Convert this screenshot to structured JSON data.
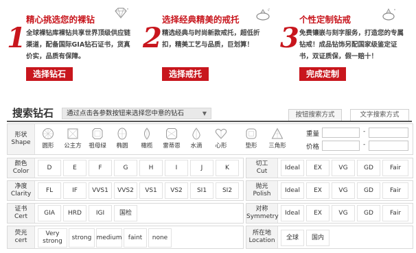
{
  "steps": [
    {
      "num": "1",
      "title": "精心挑选您的裸钻",
      "desc": "全球裸钻库裸钻共享世界顶级供应链渠道，配备国际GIA钻石证书，货真价实，品质有保障。",
      "button": "选择钻石"
    },
    {
      "num": "2",
      "title": "选择经典精美的戒托",
      "desc": "精选经典与时尚新款戒托，超低折扣，精美工艺与品质，巨划算！",
      "button": "选择戒托"
    },
    {
      "num": "3",
      "title": "个性定制钻戒",
      "desc": "免费镶嵌与刻字服务，打造您的专属钻戒！成品钻饰另配国家级鉴定证书，双证质保，假一赔十！",
      "button": "完成定制"
    }
  ],
  "search": {
    "title": "搜索钻石",
    "hint": "通过点击各参数按钮来选择您中意的钻石",
    "tab_button": "按钮搜索方式",
    "tab_text": "文字搜索方式"
  },
  "shape": {
    "label_cn": "形状",
    "label_en": "Shape",
    "items": [
      "圆形",
      "公主方",
      "祖母绿",
      "椭圆",
      "橄榄",
      "雷蒂恩",
      "水滴",
      "心形",
      "垫形",
      "三角形"
    ],
    "weight": "重量",
    "price": "价格",
    "dash": "-"
  },
  "color": {
    "label_cn": "颜色",
    "label_en": "Color",
    "values": [
      "D",
      "E",
      "F",
      "G",
      "H",
      "I",
      "J",
      "K"
    ]
  },
  "clarity": {
    "label_cn": "净度",
    "label_en": "Clarity",
    "values": [
      "FL",
      "IF",
      "VVS1",
      "VVS2",
      "VS1",
      "VS2",
      "SI1",
      "SI2"
    ]
  },
  "cert": {
    "label_cn": "证书",
    "label_en": "Cert",
    "values": [
      "GIA",
      "HRD",
      "IGI",
      "国检"
    ]
  },
  "fluor": {
    "label_cn": "荧光",
    "label_en": "cert",
    "values": [
      "Very strong",
      "strong",
      "medium",
      "faint",
      "none"
    ]
  },
  "cut": {
    "label_cn": "切工",
    "label_en": "Cut",
    "values": [
      "Ideal",
      "EX",
      "VG",
      "GD",
      "Fair"
    ]
  },
  "polish": {
    "label_cn": "抛光",
    "label_en": "Polish",
    "values": [
      "Ideal",
      "EX",
      "VG",
      "GD",
      "Fair"
    ]
  },
  "symmetry": {
    "label_cn": "对称",
    "label_en": "Symmetry",
    "values": [
      "Ideal",
      "EX",
      "VG",
      "GD",
      "Fair"
    ]
  },
  "location": {
    "label_cn": "所在地",
    "label_en": "Location",
    "values": [
      "全球",
      "国内"
    ]
  },
  "colors": {
    "accent": "#c8161d",
    "tab_line": "#555555",
    "label_bg": "#f3f3f3"
  }
}
